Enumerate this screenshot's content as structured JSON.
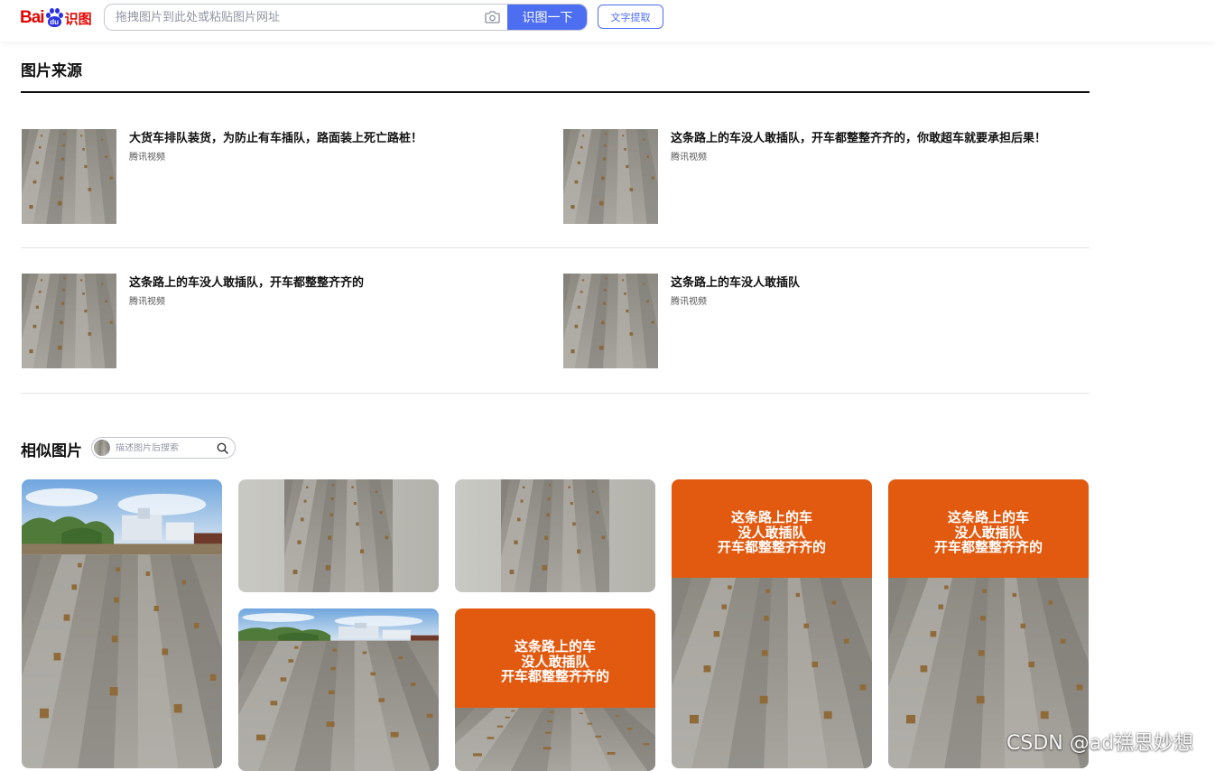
{
  "header": {
    "logo_text": "Bai",
    "logo_paw_text": "du",
    "logo_suffix": "识图",
    "search_placeholder": "拖拽图片到此处或粘贴图片网址",
    "search_button": "识图一下",
    "text_extract_button": "文字提取"
  },
  "source_section": {
    "title": "图片来源",
    "items": [
      {
        "title": "大货车排队装货，为防止有车插队，路面装上死亡路桩！",
        "origin": "腾讯视频"
      },
      {
        "title": "这条路上的车没人敢插队，开车都整整齐齐的，你敢超车就要承担后果！",
        "origin": "腾讯视频"
      },
      {
        "title": "这条路上的车没人敢插队，开车都整整齐齐的",
        "origin": "腾讯视频"
      },
      {
        "title": "这条路上的车没人敢插队",
        "origin": "腾讯视频"
      }
    ]
  },
  "similar_section": {
    "title": "相似图片",
    "search_placeholder": "描述图片后搜索",
    "overlay_lines": [
      "这条路上的车",
      "没人敢插队",
      "开车都整整齐齐的"
    ]
  },
  "watermark": "CSDN @ad禚思妙想",
  "colors": {
    "accent": "#4e6ef2",
    "logo_red": "#e10602",
    "logo_blue": "#2932e1",
    "overlay_orange": "#e15a10"
  }
}
